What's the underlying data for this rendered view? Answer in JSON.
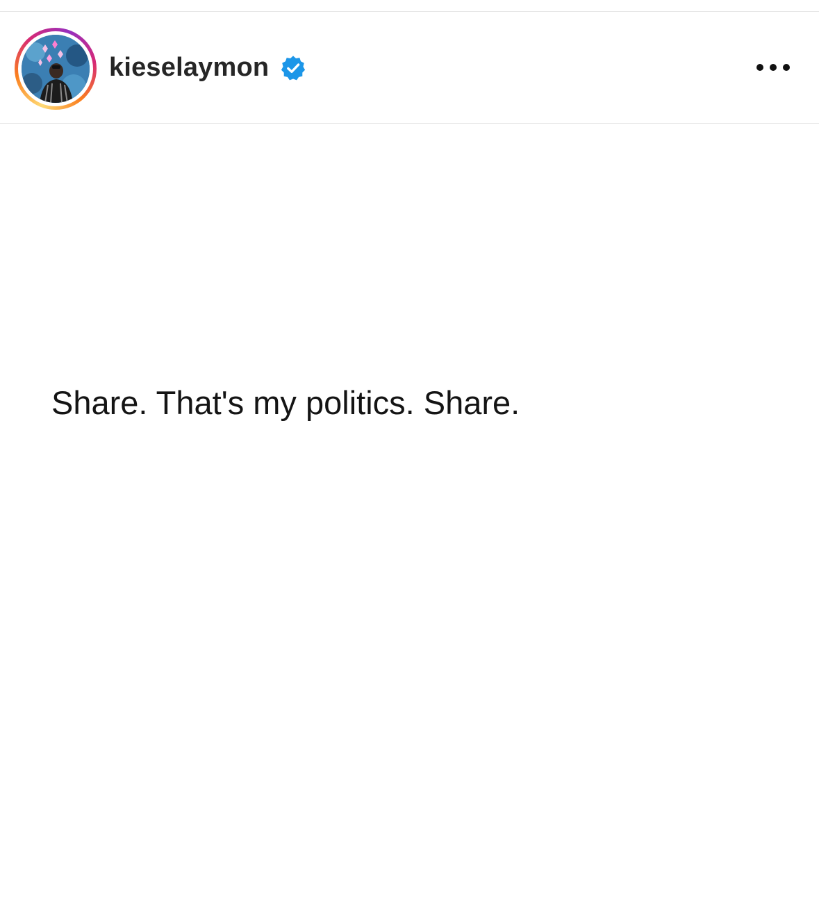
{
  "post": {
    "username": "kieselaymon",
    "verified": true,
    "text": "Share. That's my politics. Share."
  },
  "icons": {
    "verified": "verified-badge-icon",
    "more": "more-horizontal-icon"
  },
  "colors": {
    "verified_blue": "#1c96e8",
    "username_text": "#262626",
    "story_ring": [
      "#feda75",
      "#fa7e1e",
      "#d62976",
      "#962fbf"
    ]
  }
}
